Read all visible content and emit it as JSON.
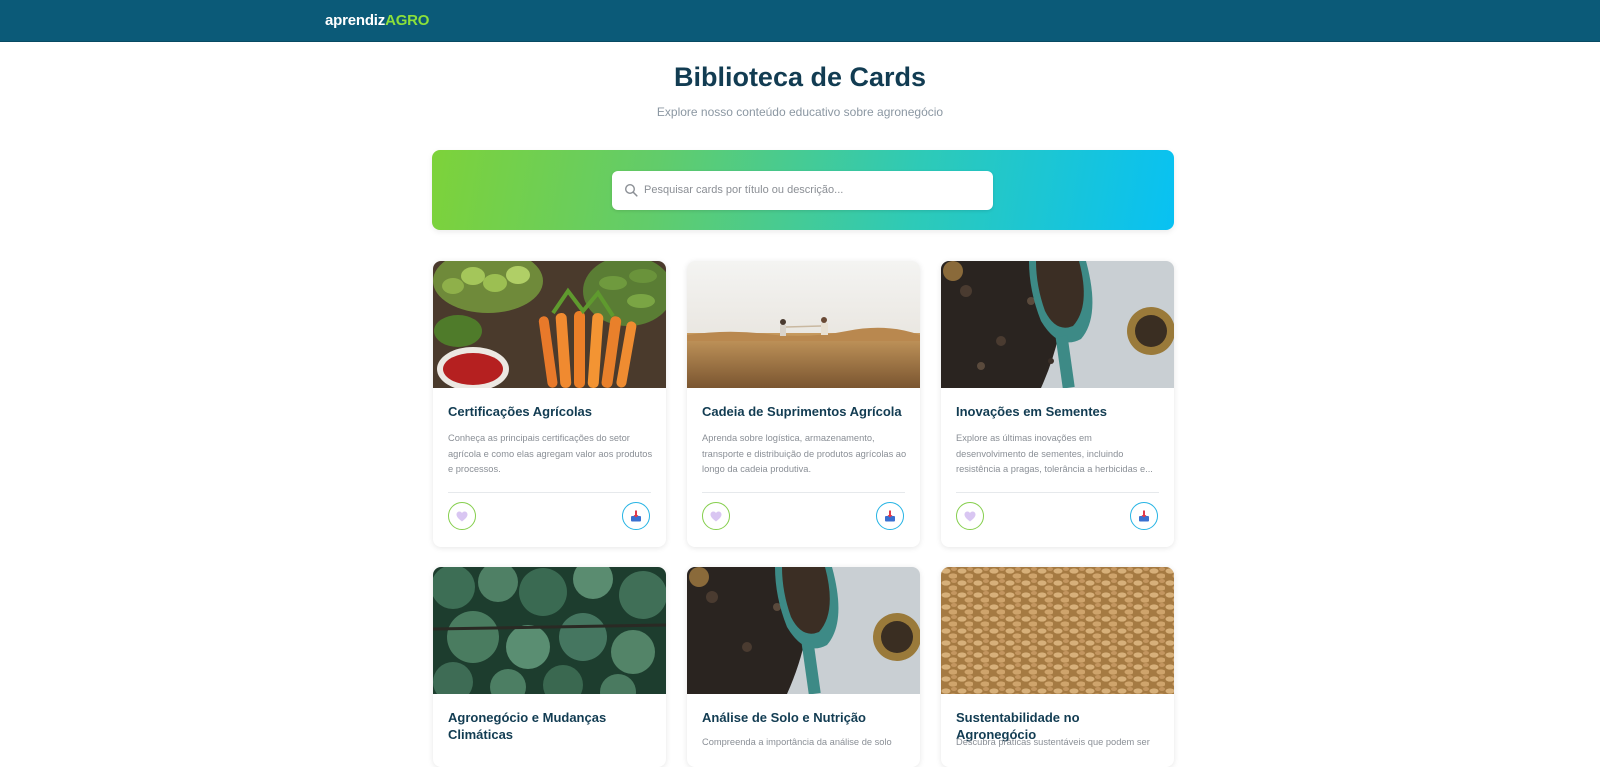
{
  "header": {
    "logo_part1": "aprendiz",
    "logo_part2": "AGRO",
    "logo_colors": {
      "part1": "#ffffff",
      "part2": "#8be03a"
    },
    "background": "#0b5a78"
  },
  "page": {
    "title": "Biblioteca de Cards",
    "subtitle": "Explore nosso conteúdo educativo sobre agronegócio"
  },
  "search": {
    "placeholder": "Pesquisar cards por título ou descrição...",
    "value": "",
    "icon": "search-icon"
  },
  "cards": [
    {
      "title": "Certificações Agrícolas",
      "description": "Conheça as principais certificações do setor agrícola e como elas agregam valor aos produtos e processos.",
      "image": "vegetables-market-photo",
      "like_icon": "heart-icon",
      "save_icon": "save-icon"
    },
    {
      "title": "Cadeia de Suprimentos Agrícola",
      "description": "Aprenda sobre logística, armazenamento, transporte e distribuição de produtos agrícolas ao longo da cadeia produtiva.",
      "image": "wheat-field-photo",
      "like_icon": "heart-icon",
      "save_icon": "save-icon"
    },
    {
      "title": "Inovações em Sementes",
      "description": "Explore as últimas inovações em desenvolvimento de sementes, incluindo resistência a pragas, tolerância a herbicidas e...",
      "image": "soil-scoop-photo",
      "like_icon": "heart-icon",
      "save_icon": "save-icon"
    },
    {
      "title": "Agronegócio e Mudanças Climáticas",
      "description": "",
      "image": "forest-aerial-photo",
      "like_icon": "heart-icon",
      "save_icon": "save-icon"
    },
    {
      "title": "Análise de Solo e Nutrição",
      "description": "Compreenda a importância da análise de solo",
      "image": "soil-scoop-photo",
      "like_icon": "heart-icon",
      "save_icon": "save-icon"
    },
    {
      "title": "Sustentabilidade no Agronegócio",
      "description": "Descubra práticas sustentáveis que podem ser",
      "image": "wheat-grains-photo",
      "like_icon": "heart-icon",
      "save_icon": "save-icon"
    }
  ]
}
